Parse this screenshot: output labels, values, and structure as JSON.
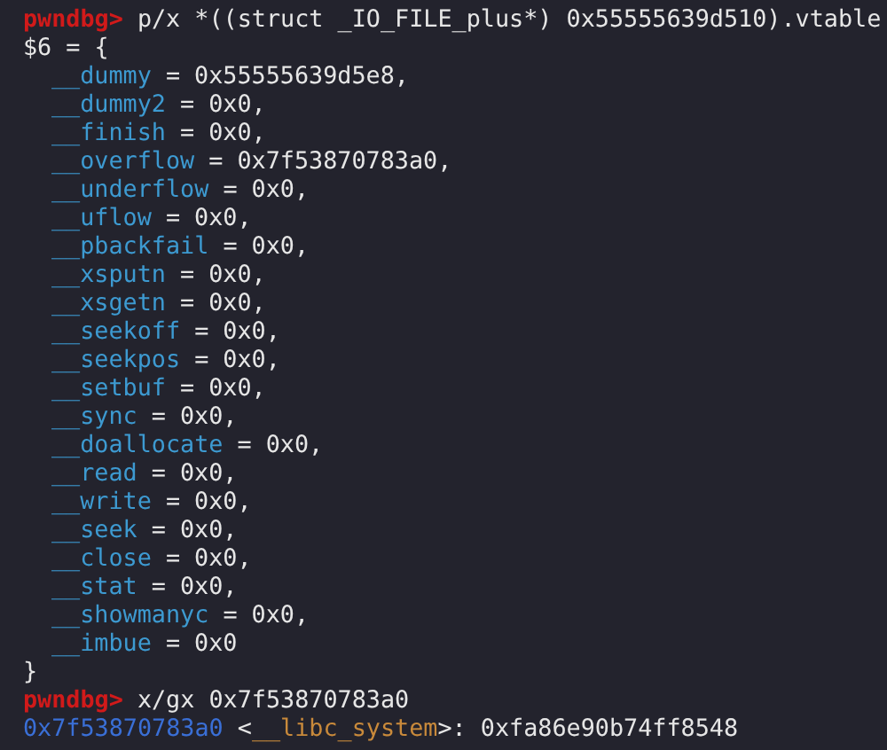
{
  "lines": [
    {
      "kind": "prompt",
      "prompt": "pwndbg>",
      "command": "p/x *((struct _IO_FILE_plus*) 0x55555639d510).vtable"
    },
    {
      "kind": "plain",
      "text": "$6 = {"
    },
    {
      "kind": "field",
      "name": "__dummy",
      "rest": "= 0x55555639d5e8,"
    },
    {
      "kind": "field",
      "name": "__dummy2",
      "rest": "= 0x0,"
    },
    {
      "kind": "field",
      "name": "__finish",
      "rest": "= 0x0,"
    },
    {
      "kind": "field",
      "name": "__overflow",
      "rest": "= 0x7f53870783a0,"
    },
    {
      "kind": "field",
      "name": "__underflow",
      "rest": "= 0x0,"
    },
    {
      "kind": "field",
      "name": "__uflow",
      "rest": "= 0x0,"
    },
    {
      "kind": "field",
      "name": "__pbackfail",
      "rest": "= 0x0,"
    },
    {
      "kind": "field",
      "name": "__xsputn",
      "rest": "= 0x0,"
    },
    {
      "kind": "field",
      "name": "__xsgetn",
      "rest": "= 0x0,"
    },
    {
      "kind": "field",
      "name": "__seekoff",
      "rest": "= 0x0,"
    },
    {
      "kind": "field",
      "name": "__seekpos",
      "rest": "= 0x0,"
    },
    {
      "kind": "field",
      "name": "__setbuf",
      "rest": "= 0x0,"
    },
    {
      "kind": "field",
      "name": "__sync",
      "rest": "= 0x0,"
    },
    {
      "kind": "field",
      "name": "__doallocate",
      "rest": "= 0x0,"
    },
    {
      "kind": "field",
      "name": "__read",
      "rest": "= 0x0,"
    },
    {
      "kind": "field",
      "name": "__write",
      "rest": "= 0x0,"
    },
    {
      "kind": "field",
      "name": "__seek",
      "rest": "= 0x0,"
    },
    {
      "kind": "field",
      "name": "__close",
      "rest": "= 0x0,"
    },
    {
      "kind": "field",
      "name": "__stat",
      "rest": "= 0x0,"
    },
    {
      "kind": "field",
      "name": "__showmanyc",
      "rest": "= 0x0,"
    },
    {
      "kind": "field",
      "name": "__imbue",
      "rest": "= 0x0"
    },
    {
      "kind": "plain",
      "text": "}"
    },
    {
      "kind": "prompt",
      "prompt": "pwndbg>",
      "command": "x/gx 0x7f53870783a0"
    },
    {
      "kind": "symbol",
      "address": "0x7f53870783a0",
      "open": "<",
      "symbol": "__libc_system",
      "rest": ">: 0xfa86e90b74ff8548"
    }
  ]
}
